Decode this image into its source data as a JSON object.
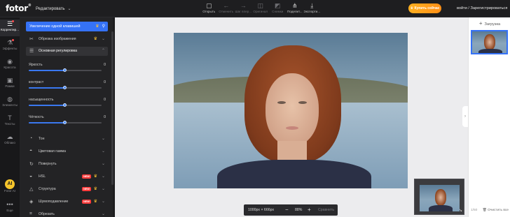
{
  "app": {
    "logo": "fotor",
    "logo_mark": "®",
    "mode": "Редактировать"
  },
  "toolbar": [
    {
      "icon": "open-icon",
      "glyph": "▢",
      "label": "Открыть",
      "enabled": true
    },
    {
      "icon": "undo-icon",
      "glyph": "←",
      "label": "Отменить",
      "enabled": false
    },
    {
      "icon": "redo-icon",
      "glyph": "→",
      "label": "Шаг впер...",
      "enabled": false
    },
    {
      "icon": "original-icon",
      "glyph": "◫",
      "label": "Оригинал",
      "enabled": false
    },
    {
      "icon": "history-icon",
      "glyph": "◩",
      "label": "Снимки",
      "enabled": false
    },
    {
      "icon": "share-icon",
      "glyph": "⋔",
      "label": "Поделит...",
      "enabled": true
    },
    {
      "icon": "download-icon",
      "glyph": "⤓",
      "label": "Экспорти...",
      "enabled": true
    }
  ],
  "header": {
    "buy_label": "Купить сейчас",
    "login_label": "войти / Зарегистрироваться"
  },
  "leftnav": [
    {
      "icon": "adjust-icon",
      "glyph": "☰",
      "label": "Корректир...",
      "active": true,
      "dot": true
    },
    {
      "icon": "effects-icon",
      "glyph": "⚗",
      "label": "Эффекты",
      "active": false,
      "dot": true
    },
    {
      "icon": "beauty-icon",
      "glyph": "◉",
      "label": "Красота",
      "active": false,
      "dot": false
    },
    {
      "icon": "frames-icon",
      "glyph": "▣",
      "label": "Рамки",
      "active": false,
      "dot": false
    },
    {
      "icon": "elements-icon",
      "glyph": "◍",
      "label": "Элементы",
      "active": false,
      "dot": false
    },
    {
      "icon": "text-icon",
      "glyph": "T",
      "label": "Тексты",
      "active": false,
      "dot": false
    },
    {
      "icon": "cloud-icon",
      "glyph": "☁",
      "label": "Облако",
      "active": false,
      "dot": false
    },
    {
      "icon": "ai-icon",
      "glyph": "AI",
      "label": "Fotor AI",
      "active": false,
      "dot": false
    },
    {
      "icon": "more-icon",
      "glyph": "•••",
      "label": "Еще",
      "active": false,
      "dot": false
    }
  ],
  "panel": {
    "upscale_label": "Увеличение одной клавишей",
    "bg_remover_label": "Обрезка изображения",
    "basic_section_label": "Основная регулировка",
    "sliders": [
      {
        "label": "Яркость",
        "value": 0
      },
      {
        "label": "контраст",
        "value": 0
      },
      {
        "label": "насыщенность",
        "value": 0
      },
      {
        "label": "Чёткость",
        "value": 0
      }
    ],
    "sections": [
      {
        "icon": "tone-icon",
        "glyph": "◔",
        "label": "Тон",
        "new": false,
        "premium": false
      },
      {
        "icon": "curve-icon",
        "glyph": "◓",
        "label": "Цветовая гамма",
        "new": false,
        "premium": false
      },
      {
        "icon": "rotate-icon",
        "glyph": "↻",
        "label": "Повернуть",
        "new": false,
        "premium": false
      },
      {
        "icon": "hsl-icon",
        "glyph": "◒",
        "label": "HSL",
        "new": true,
        "premium": true
      },
      {
        "icon": "structure-icon",
        "glyph": "△",
        "label": "Структура",
        "new": true,
        "premium": true
      },
      {
        "icon": "denoise-icon",
        "glyph": "◈",
        "label": "Шумоподавление",
        "new": true,
        "premium": true
      },
      {
        "icon": "crop-icon",
        "glyph": "⌗",
        "label": "Обрезать",
        "new": false,
        "premium": false
      }
    ],
    "badge_new": "NEW"
  },
  "canvas": {
    "dimensions_label": "1000px × 666px",
    "zoom_label": "88%",
    "compare_label": "Сравнить"
  },
  "rightpanel": {
    "upload_label": "Загрузка",
    "count_label": "1/50",
    "clear_label": "Очистить все"
  },
  "colors": {
    "accent": "#3572f6",
    "buy": "#ff9f1a",
    "panel": "#232325",
    "canvas": "#ececee"
  }
}
